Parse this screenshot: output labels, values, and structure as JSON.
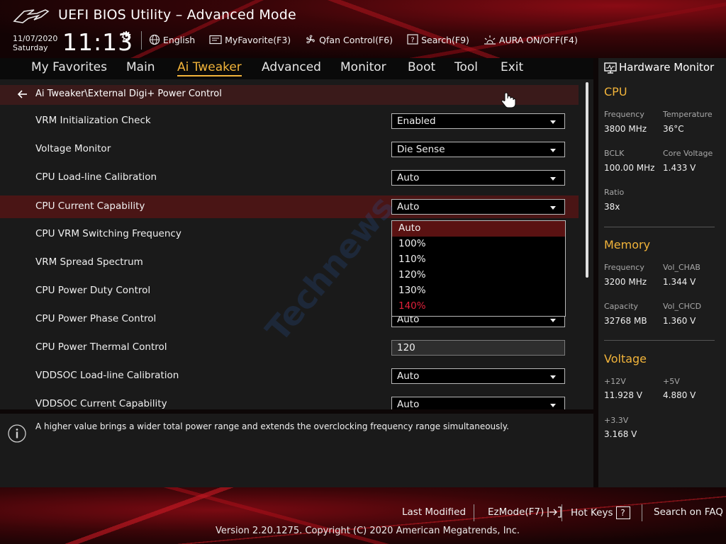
{
  "header": {
    "title": "UEFI BIOS Utility – Advanced Mode",
    "date": "11/07/2020",
    "day": "Saturday",
    "time": "11:13",
    "toolbar": [
      {
        "label": "English",
        "icon": "globe-icon"
      },
      {
        "label": "MyFavorite(F3)",
        "icon": "favorite-icon"
      },
      {
        "label": "Qfan Control(F6)",
        "icon": "fan-icon"
      },
      {
        "label": "Search(F9)",
        "icon": "search-help-icon"
      },
      {
        "label": "AURA ON/OFF(F4)",
        "icon": "aura-icon"
      }
    ]
  },
  "menu": {
    "items": [
      "My Favorites",
      "Main",
      "Ai Tweaker",
      "Advanced",
      "Monitor",
      "Boot",
      "Tool",
      "Exit"
    ],
    "active": "Ai Tweaker"
  },
  "content": {
    "breadcrumb": "Ai Tweaker\\External Digi+ Power Control",
    "settings": [
      {
        "label": "VRM Initialization Check",
        "value": "Enabled",
        "kind": "dropdown"
      },
      {
        "label": "Voltage Monitor",
        "value": "Die Sense",
        "kind": "dropdown"
      },
      {
        "label": "CPU Load-line Calibration",
        "value": "Auto",
        "kind": "dropdown"
      },
      {
        "label": "CPU Current Capability",
        "value": "Auto",
        "kind": "dropdown"
      },
      {
        "label": "CPU VRM Switching Frequency",
        "value": "",
        "kind": "hidden"
      },
      {
        "label": "VRM Spread Spectrum",
        "value": "",
        "kind": "hidden"
      },
      {
        "label": "CPU Power Duty Control",
        "value": "",
        "kind": "hidden"
      },
      {
        "label": "CPU Power Phase Control",
        "value": "Auto",
        "kind": "dropdown"
      },
      {
        "label": "CPU Power Thermal Control",
        "value": "120",
        "kind": "text"
      },
      {
        "label": "VDDSOC Load-line Calibration",
        "value": "Auto",
        "kind": "dropdown"
      },
      {
        "label": "VDDSOC Current Capability",
        "value": "Auto",
        "kind": "dropdown"
      }
    ],
    "selected_row": "CPU Current Capability",
    "popup_options": [
      "Auto",
      "100%",
      "110%",
      "120%",
      "130%",
      "140%"
    ],
    "popup_current": "Auto",
    "popup_danger": "140%",
    "danger_color": "#e0203a"
  },
  "help": {
    "text": "A higher value brings a wider total power range and extends the overclocking frequency range simultaneously."
  },
  "watermark": "Technews",
  "hardware_monitor": {
    "title": "Hardware Monitor",
    "accent_color": "#f2b43a",
    "cpu": {
      "heading": "CPU",
      "frequency_label": "Frequency",
      "frequency": "3800 MHz",
      "temperature_label": "Temperature",
      "temperature": "36°C",
      "bclk_label": "BCLK",
      "bclk": "100.00 MHz",
      "core_voltage_label": "Core Voltage",
      "core_voltage": "1.433 V",
      "ratio_label": "Ratio",
      "ratio": "38x"
    },
    "memory": {
      "heading": "Memory",
      "frequency_label": "Frequency",
      "frequency": "3200 MHz",
      "vol_chab_label": "Vol_CHAB",
      "vol_chab": "1.344 V",
      "capacity_label": "Capacity",
      "capacity": "32768 MB",
      "vol_chcd_label": "Vol_CHCD",
      "vol_chcd": "1.360 V"
    },
    "voltage": {
      "heading": "Voltage",
      "v12_label": "+12V",
      "v12": "11.928 V",
      "v5_label": "+5V",
      "v5": "4.880 V",
      "v33_label": "+3.3V",
      "v33": "3.168 V"
    }
  },
  "footer": {
    "last_modified": "Last Modified",
    "ezmode": "EzMode(F7)",
    "hot_keys": "Hot Keys",
    "hot_keys_key": "?",
    "search_faq": "Search on FAQ",
    "copyright": "Version 2.20.1275. Copyright (C) 2020 American Megatrends, Inc."
  }
}
